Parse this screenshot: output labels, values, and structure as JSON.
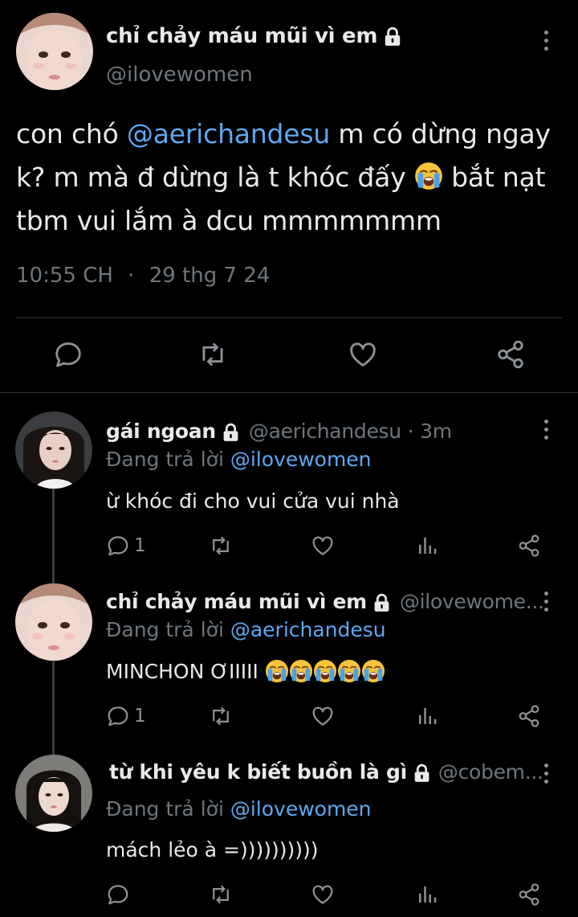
{
  "main_tweet": {
    "display_name": "chỉ chảy máu mũi vì em",
    "handle": "@ilovewomen",
    "text_before": "con chó ",
    "mention": "@aerichandesu",
    "text_mid": " m có dừng ngay k? m mà đ dừng là t khóc đấy ",
    "text_after": " bắt nạt tbm vui lắm à dcu mmmmmmm",
    "time": "10:55 CH",
    "separator": "·",
    "date": "29 thg 7 24"
  },
  "icons": {
    "lock": "lock-icon",
    "more": "more-vertical-icon",
    "reply": "reply-icon",
    "retweet": "retweet-icon",
    "like": "like-icon",
    "share": "share-icon",
    "views": "analytics-icon",
    "emoji": "loudly-crying-face-emoji"
  },
  "colors": {
    "background": "#000000",
    "text": "#e7e9ea",
    "secondary": "#6e767d",
    "mention": "#5ea8f0",
    "divider": "#2f3336"
  },
  "replies": [
    {
      "display_name": "gái ngoan",
      "handle": "@aerichandesu",
      "time": "· 3m",
      "replying_prefix": "Đang trả lời ",
      "replying_to": "@ilovewomen",
      "text": "ừ khóc đi cho vui cửa vui nhà",
      "reply_count": "1"
    },
    {
      "display_name": "chỉ chảy máu mũi vì em",
      "handle": "@ilovewome...",
      "time": "",
      "replying_prefix": "Đang trả lời ",
      "replying_to": "@aerichandesu",
      "text": "MINCHON ƠIIIII",
      "reply_count": "1"
    },
    {
      "display_name": "từ khi yêu k biết buồn là gì",
      "handle": "@cobem...",
      "time": "",
      "replying_prefix": "Đang trả lời ",
      "replying_to": "@ilovewomen",
      "text": "mách lẻo à =))))))))))",
      "reply_count": ""
    }
  ]
}
